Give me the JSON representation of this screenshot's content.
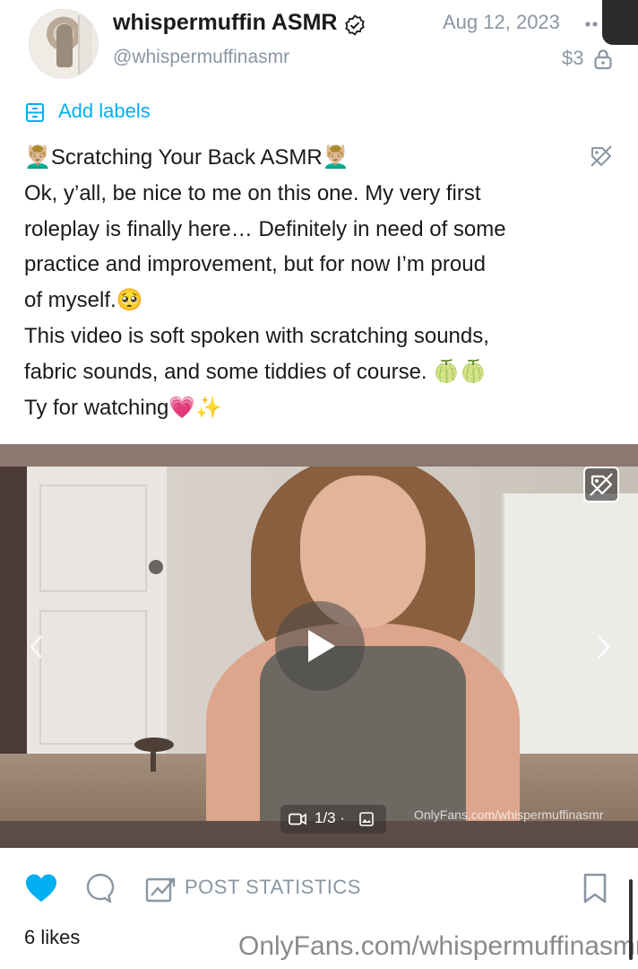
{
  "post": {
    "author": {
      "display_name": "whispermuffin ASMR",
      "handle": "@whispermuffinasmr",
      "verified": true
    },
    "date": "Aug 12, 2023",
    "price": "$3",
    "labels_action": "Add labels",
    "caption_lines": [
      "💆🏼‍♂️Scratching Your Back ASMR💆🏼‍♂️",
      "Ok, y’all, be nice to me on this one. My very first",
      "roleplay is finally here… Definitely in need of some",
      "practice and improvement, but for now I’m proud",
      "of myself.🥺",
      "This video is soft spoken with scratching sounds,",
      "fabric sounds, and some tiddies of course. 🍈🍈",
      "Ty for watching💗✨"
    ],
    "media": {
      "counter": "1/3 ·",
      "watermark": "OnlyFans.com/whispermuffinasmr"
    },
    "actions": {
      "stats_label": "POST STATISTICS",
      "liked": true
    },
    "likes": "6 likes"
  },
  "footer_watermark": "OnlyFans.com/whispermuffinasmr",
  "colors": {
    "accent": "#00aff0",
    "muted": "#8a96a3",
    "text": "#1a1a1a"
  },
  "icons": [
    "verified-icon",
    "more-icon",
    "lock-icon",
    "labels-icon",
    "tag-icon",
    "play-icon",
    "chevron-left-icon",
    "chevron-right-icon",
    "video-camera-icon",
    "image-icon",
    "heart-icon",
    "comment-icon",
    "stats-icon",
    "bookmark-icon"
  ]
}
